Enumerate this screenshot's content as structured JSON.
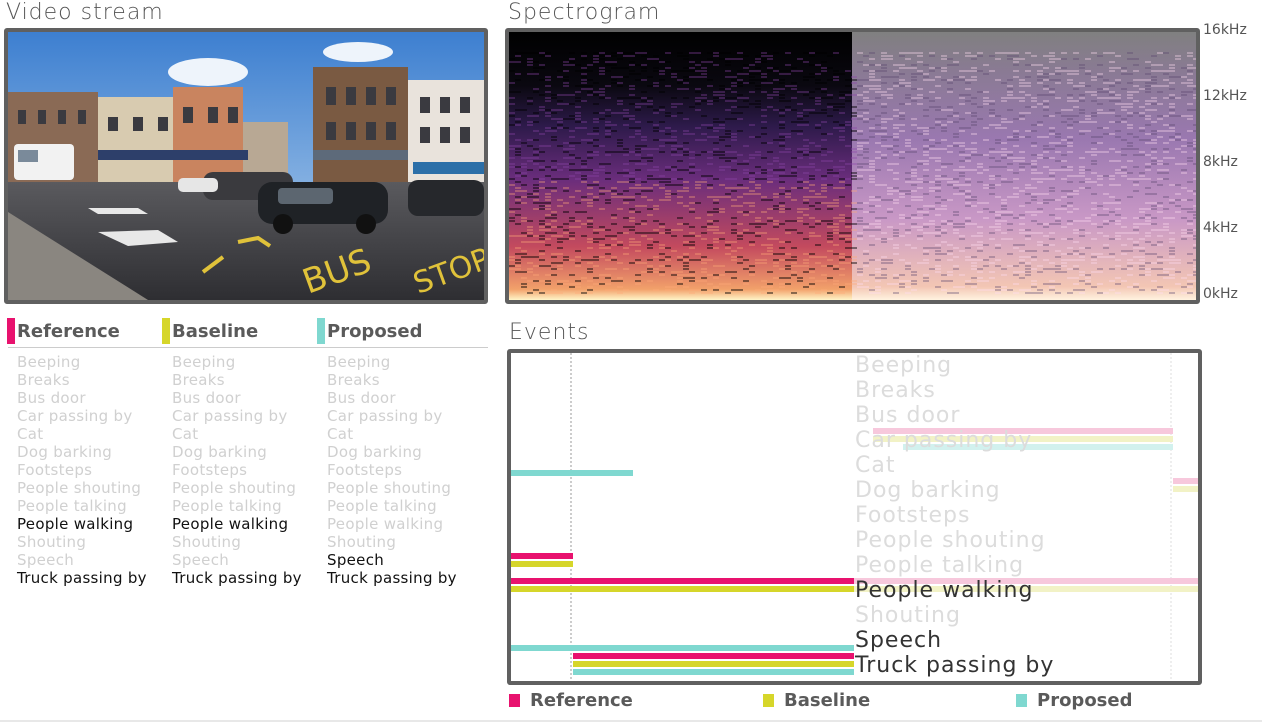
{
  "panels": {
    "video_title": "Video stream",
    "spectrogram_title": "Spectrogram",
    "events_title": "Events"
  },
  "spectrogram": {
    "freq_labels": [
      "16kHz",
      "12kHz",
      "8kHz",
      "4kHz",
      "0kHz"
    ]
  },
  "colors": {
    "reference": "#e8126e",
    "baseline": "#d6d62a",
    "proposed": "#7fd8d0",
    "frame": "#606060"
  },
  "classes": [
    "Beeping",
    "Breaks",
    "Bus door",
    "Car passing by",
    "Cat",
    "Dog barking",
    "Footsteps",
    "People shouting",
    "People talking",
    "People walking",
    "Shouting",
    "Speech",
    "Truck passing by"
  ],
  "legend": {
    "reference_label": "Reference",
    "baseline_label": "Baseline",
    "proposed_label": "Proposed",
    "active": {
      "reference": [
        "People walking",
        "Truck passing by"
      ],
      "baseline": [
        "People walking",
        "Truck passing by"
      ],
      "proposed": [
        "Speech",
        "Truck passing by"
      ]
    }
  },
  "events": {
    "active": [
      "People walking",
      "Speech",
      "Truck passing by"
    ]
  }
}
